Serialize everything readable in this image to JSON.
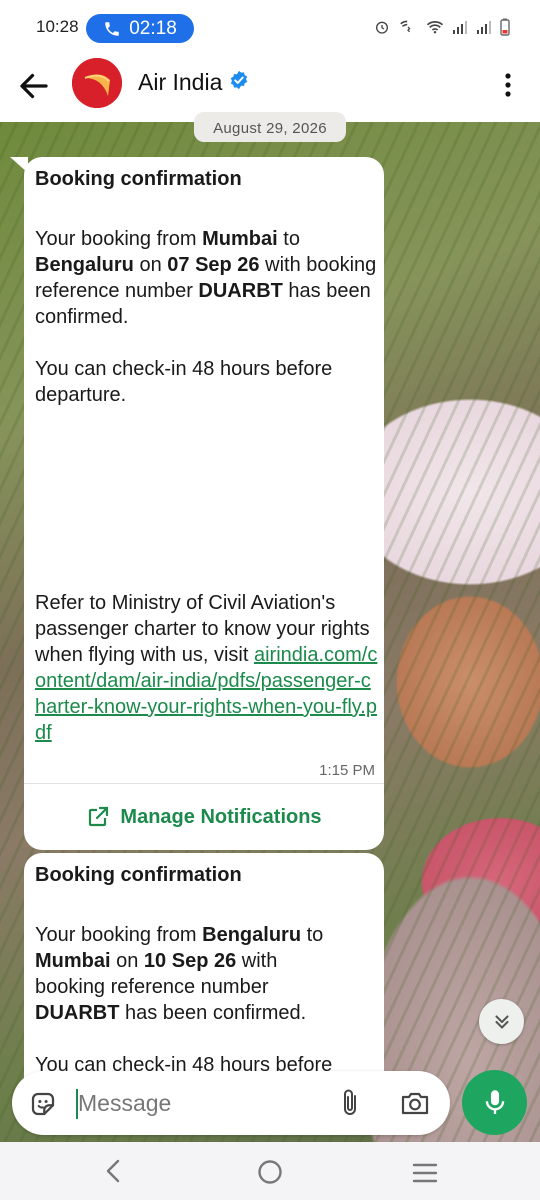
{
  "status_bar": {
    "time": "10:28",
    "call_timer": "02:18",
    "icons": [
      "alarm-icon",
      "wifi-call-icon",
      "wifi-icon",
      "signal-icon",
      "signal-icon",
      "battery-low-icon"
    ]
  },
  "app_bar": {
    "title": "Air India",
    "verified": true
  },
  "date_chip": "August 29, 2026",
  "messages": [
    {
      "title": "Booking confirmation",
      "p1": {
        "t1": "Your booking from ",
        "from": "Mumbai",
        "t2": " to ",
        "to": "Bengaluru",
        "t3": " on ",
        "date": "07 Sep 26",
        "t4": " with booking reference number ",
        "ref": "DUARBT",
        "t5": " has been confirmed."
      },
      "p2": "You can check-in 48 hours before departure.",
      "p3": "Refer to Ministry of Civil Aviation's passenger charter to know your rights when flying with us, visit ",
      "link": "airindia.com/content/dam/air-india/pdfs/passenger-charter-know-your-rights-when-you-fly.pdf",
      "time": "1:15 PM",
      "action": "Manage Notifications"
    },
    {
      "title": "Booking confirmation",
      "p1": {
        "t1": "Your booking from ",
        "from": "Bengaluru",
        "t2": " to ",
        "to": "Mumbai",
        "t3": " on ",
        "date": "10 Sep 26",
        "t4": " with booking reference number ",
        "ref": "DUARBT",
        "t5": " has been confirmed."
      },
      "p2": "You can check-in 48 hours before"
    }
  ],
  "composer": {
    "placeholder": "Message"
  },
  "colors": {
    "accent_green": "#1b8a4b",
    "mic_green": "#1ea660",
    "call_pill_blue": "#1f6fe8",
    "brand_red": "#d8202a",
    "verified_blue": "#1d8cf0"
  }
}
